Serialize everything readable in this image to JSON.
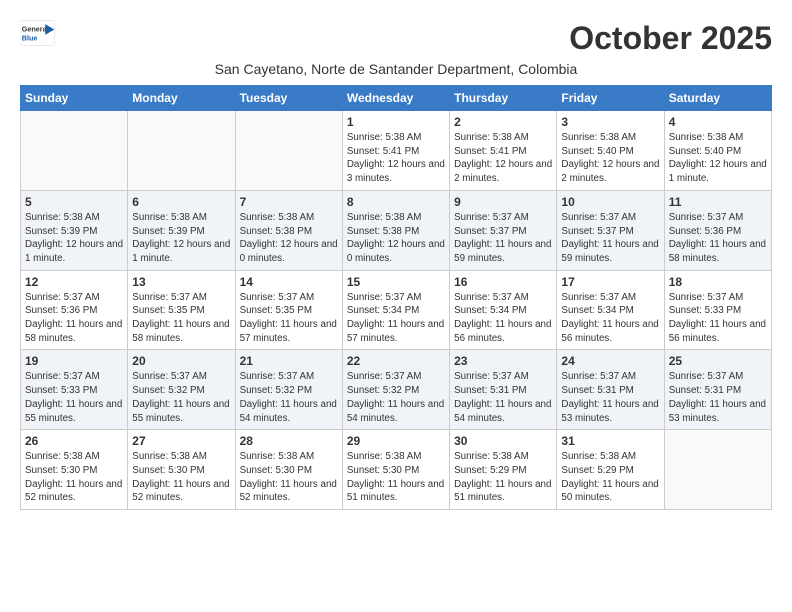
{
  "logo": {
    "line1": "General",
    "line2": "Blue"
  },
  "title": "October 2025",
  "subtitle": "San Cayetano, Norte de Santander Department, Colombia",
  "days_of_week": [
    "Sunday",
    "Monday",
    "Tuesday",
    "Wednesday",
    "Thursday",
    "Friday",
    "Saturday"
  ],
  "weeks": [
    {
      "shaded": false,
      "days": [
        {
          "number": "",
          "info": ""
        },
        {
          "number": "",
          "info": ""
        },
        {
          "number": "",
          "info": ""
        },
        {
          "number": "1",
          "info": "Sunrise: 5:38 AM\nSunset: 5:41 PM\nDaylight: 12 hours and 3 minutes."
        },
        {
          "number": "2",
          "info": "Sunrise: 5:38 AM\nSunset: 5:41 PM\nDaylight: 12 hours and 2 minutes."
        },
        {
          "number": "3",
          "info": "Sunrise: 5:38 AM\nSunset: 5:40 PM\nDaylight: 12 hours and 2 minutes."
        },
        {
          "number": "4",
          "info": "Sunrise: 5:38 AM\nSunset: 5:40 PM\nDaylight: 12 hours and 1 minute."
        }
      ]
    },
    {
      "shaded": true,
      "days": [
        {
          "number": "5",
          "info": "Sunrise: 5:38 AM\nSunset: 5:39 PM\nDaylight: 12 hours and 1 minute."
        },
        {
          "number": "6",
          "info": "Sunrise: 5:38 AM\nSunset: 5:39 PM\nDaylight: 12 hours and 1 minute."
        },
        {
          "number": "7",
          "info": "Sunrise: 5:38 AM\nSunset: 5:38 PM\nDaylight: 12 hours and 0 minutes."
        },
        {
          "number": "8",
          "info": "Sunrise: 5:38 AM\nSunset: 5:38 PM\nDaylight: 12 hours and 0 minutes."
        },
        {
          "number": "9",
          "info": "Sunrise: 5:37 AM\nSunset: 5:37 PM\nDaylight: 11 hours and 59 minutes."
        },
        {
          "number": "10",
          "info": "Sunrise: 5:37 AM\nSunset: 5:37 PM\nDaylight: 11 hours and 59 minutes."
        },
        {
          "number": "11",
          "info": "Sunrise: 5:37 AM\nSunset: 5:36 PM\nDaylight: 11 hours and 58 minutes."
        }
      ]
    },
    {
      "shaded": false,
      "days": [
        {
          "number": "12",
          "info": "Sunrise: 5:37 AM\nSunset: 5:36 PM\nDaylight: 11 hours and 58 minutes."
        },
        {
          "number": "13",
          "info": "Sunrise: 5:37 AM\nSunset: 5:35 PM\nDaylight: 11 hours and 58 minutes."
        },
        {
          "number": "14",
          "info": "Sunrise: 5:37 AM\nSunset: 5:35 PM\nDaylight: 11 hours and 57 minutes."
        },
        {
          "number": "15",
          "info": "Sunrise: 5:37 AM\nSunset: 5:34 PM\nDaylight: 11 hours and 57 minutes."
        },
        {
          "number": "16",
          "info": "Sunrise: 5:37 AM\nSunset: 5:34 PM\nDaylight: 11 hours and 56 minutes."
        },
        {
          "number": "17",
          "info": "Sunrise: 5:37 AM\nSunset: 5:34 PM\nDaylight: 11 hours and 56 minutes."
        },
        {
          "number": "18",
          "info": "Sunrise: 5:37 AM\nSunset: 5:33 PM\nDaylight: 11 hours and 56 minutes."
        }
      ]
    },
    {
      "shaded": true,
      "days": [
        {
          "number": "19",
          "info": "Sunrise: 5:37 AM\nSunset: 5:33 PM\nDaylight: 11 hours and 55 minutes."
        },
        {
          "number": "20",
          "info": "Sunrise: 5:37 AM\nSunset: 5:32 PM\nDaylight: 11 hours and 55 minutes."
        },
        {
          "number": "21",
          "info": "Sunrise: 5:37 AM\nSunset: 5:32 PM\nDaylight: 11 hours and 54 minutes."
        },
        {
          "number": "22",
          "info": "Sunrise: 5:37 AM\nSunset: 5:32 PM\nDaylight: 11 hours and 54 minutes."
        },
        {
          "number": "23",
          "info": "Sunrise: 5:37 AM\nSunset: 5:31 PM\nDaylight: 11 hours and 54 minutes."
        },
        {
          "number": "24",
          "info": "Sunrise: 5:37 AM\nSunset: 5:31 PM\nDaylight: 11 hours and 53 minutes."
        },
        {
          "number": "25",
          "info": "Sunrise: 5:37 AM\nSunset: 5:31 PM\nDaylight: 11 hours and 53 minutes."
        }
      ]
    },
    {
      "shaded": false,
      "days": [
        {
          "number": "26",
          "info": "Sunrise: 5:38 AM\nSunset: 5:30 PM\nDaylight: 11 hours and 52 minutes."
        },
        {
          "number": "27",
          "info": "Sunrise: 5:38 AM\nSunset: 5:30 PM\nDaylight: 11 hours and 52 minutes."
        },
        {
          "number": "28",
          "info": "Sunrise: 5:38 AM\nSunset: 5:30 PM\nDaylight: 11 hours and 52 minutes."
        },
        {
          "number": "29",
          "info": "Sunrise: 5:38 AM\nSunset: 5:30 PM\nDaylight: 11 hours and 51 minutes."
        },
        {
          "number": "30",
          "info": "Sunrise: 5:38 AM\nSunset: 5:29 PM\nDaylight: 11 hours and 51 minutes."
        },
        {
          "number": "31",
          "info": "Sunrise: 5:38 AM\nSunset: 5:29 PM\nDaylight: 11 hours and 50 minutes."
        },
        {
          "number": "",
          "info": ""
        }
      ]
    }
  ]
}
